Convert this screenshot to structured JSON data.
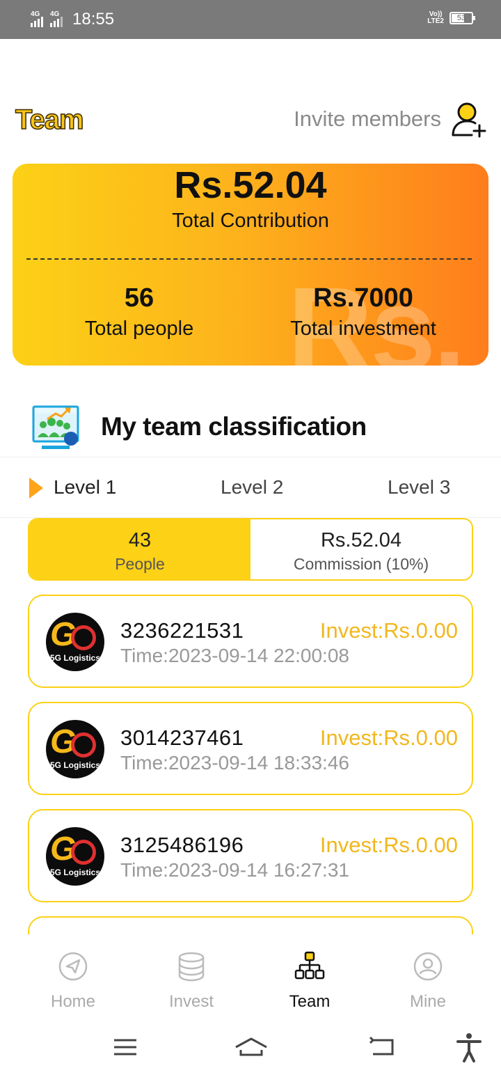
{
  "status_bar": {
    "network1": "4G",
    "network2": "4G",
    "time": "18:55",
    "volte": "Vo)\nLTE2",
    "volte_line1": "Vo))",
    "volte_line2": "LTE2",
    "battery": "53"
  },
  "header": {
    "title": "Team",
    "invite_label": "Invite members"
  },
  "summary": {
    "total_contribution_value": "Rs.52.04",
    "total_contribution_label": "Total Contribution",
    "total_people_value": "56",
    "total_people_label": "Total people",
    "total_investment_value": "Rs.7000",
    "total_investment_label": "Total investment",
    "watermark": "Rs."
  },
  "classification": {
    "title": "My team classification",
    "tabs": [
      {
        "label": "Level 1",
        "active": true
      },
      {
        "label": "Level 2",
        "active": false
      },
      {
        "label": "Level 3",
        "active": false
      }
    ],
    "people_value": "43",
    "people_label": "People",
    "commission_value": "Rs.52.04",
    "commission_label": "Commission (10%)"
  },
  "members": [
    {
      "phone": "3236221531",
      "time": "Time:2023-09-14 22:00:08",
      "invest": "Invest:Rs.0.00",
      "avatar_brand": "5G Logistics"
    },
    {
      "phone": "3014237461",
      "time": "Time:2023-09-14 18:33:46",
      "invest": "Invest:Rs.0.00",
      "avatar_brand": "5G Logistics"
    },
    {
      "phone": "3125486196",
      "time": "Time:2023-09-14 16:27:31",
      "invest": "Invest:Rs.0.00",
      "avatar_brand": "5G Logistics"
    }
  ],
  "bottom_nav": [
    {
      "label": "Home",
      "icon": "navigation-arrow-icon",
      "active": false
    },
    {
      "label": "Invest",
      "icon": "coin-stack-icon",
      "active": false
    },
    {
      "label": "Team",
      "icon": "org-chart-icon",
      "active": true
    },
    {
      "label": "Mine",
      "icon": "user-circle-icon",
      "active": false
    }
  ],
  "colors": {
    "accent": "#fcd116",
    "accent_orange": "#ff7d1c",
    "invest_text": "#f2b71d",
    "muted": "#999999"
  }
}
